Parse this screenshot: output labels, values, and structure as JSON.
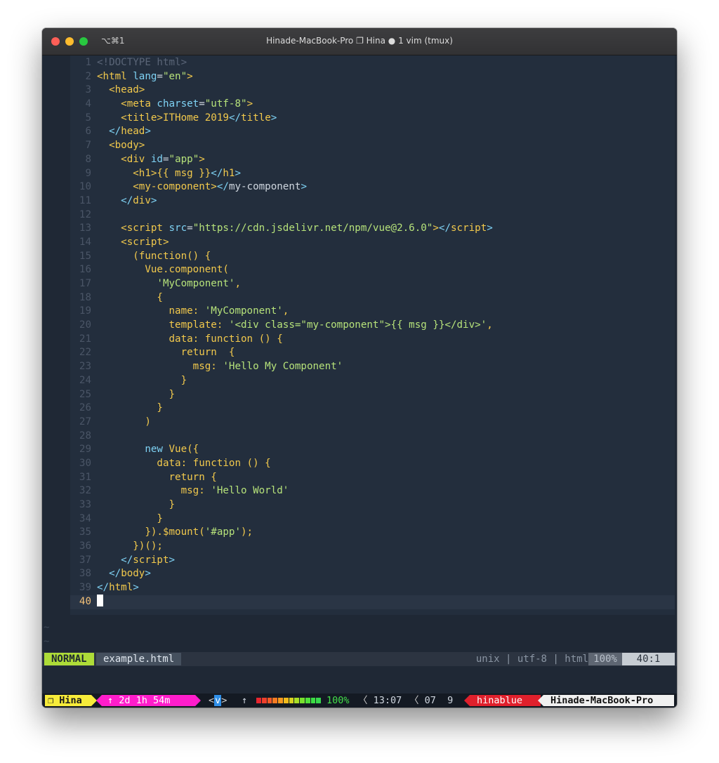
{
  "window": {
    "shortcut": "⌥⌘1",
    "title": "Hinade-MacBook-Pro ❐ Hina ● 1 vim (tmux)"
  },
  "editor": {
    "lines": [
      {
        "n": "1",
        "seg": [
          [
            "com",
            "<!DOCTYPE html>"
          ]
        ]
      },
      {
        "n": "2",
        "seg": [
          [
            "tag",
            "<html "
          ],
          [
            "attr",
            "lang"
          ],
          [
            "op",
            "="
          ],
          [
            "str",
            "\"en\""
          ],
          [
            "tag",
            ">"
          ]
        ]
      },
      {
        "n": "3",
        "seg": [
          [
            "text",
            "  "
          ],
          [
            "tag",
            "<head>"
          ]
        ]
      },
      {
        "n": "4",
        "seg": [
          [
            "text",
            "    "
          ],
          [
            "tag",
            "<meta "
          ],
          [
            "attr",
            "charset"
          ],
          [
            "op",
            "="
          ],
          [
            "str",
            "\"utf-8\""
          ],
          [
            "tag",
            ">"
          ]
        ]
      },
      {
        "n": "5",
        "seg": [
          [
            "text",
            "    "
          ],
          [
            "tag",
            "<title>"
          ],
          [
            "js",
            "ITHome 2019"
          ],
          [
            "br",
            "</"
          ],
          [
            "tag",
            "title"
          ],
          [
            "br",
            ">"
          ]
        ]
      },
      {
        "n": "6",
        "seg": [
          [
            "text",
            "  "
          ],
          [
            "br",
            "</"
          ],
          [
            "tag",
            "head"
          ],
          [
            "br",
            ">"
          ]
        ]
      },
      {
        "n": "7",
        "seg": [
          [
            "text",
            "  "
          ],
          [
            "tag",
            "<body>"
          ]
        ]
      },
      {
        "n": "8",
        "seg": [
          [
            "text",
            "    "
          ],
          [
            "tag",
            "<div "
          ],
          [
            "attr",
            "id"
          ],
          [
            "op",
            "="
          ],
          [
            "str",
            "\"app\""
          ],
          [
            "tag",
            ">"
          ]
        ]
      },
      {
        "n": "9",
        "seg": [
          [
            "text",
            "      "
          ],
          [
            "tag",
            "<h1>"
          ],
          [
            "js",
            "{{ msg }}"
          ],
          [
            "br",
            "</"
          ],
          [
            "tag",
            "h1"
          ],
          [
            "br",
            ">"
          ]
        ]
      },
      {
        "n": "10",
        "seg": [
          [
            "text",
            "      "
          ],
          [
            "tag",
            "<my-component>"
          ],
          [
            "br",
            "</"
          ],
          [
            "text",
            "my-component"
          ],
          [
            "br",
            ">"
          ]
        ]
      },
      {
        "n": "11",
        "seg": [
          [
            "text",
            "    "
          ],
          [
            "br",
            "</"
          ],
          [
            "tag",
            "div"
          ],
          [
            "br",
            ">"
          ]
        ]
      },
      {
        "n": "12",
        "seg": []
      },
      {
        "n": "13",
        "seg": [
          [
            "text",
            "    "
          ],
          [
            "tag",
            "<script "
          ],
          [
            "attr",
            "src"
          ],
          [
            "op",
            "="
          ],
          [
            "str",
            "\"https://cdn.jsdelivr.net/npm/vue@2.6.0\""
          ],
          [
            "tag",
            ">"
          ],
          [
            "br",
            "</"
          ],
          [
            "tag",
            "script"
          ],
          [
            "br",
            ">"
          ]
        ]
      },
      {
        "n": "14",
        "seg": [
          [
            "text",
            "    "
          ],
          [
            "tag",
            "<script>"
          ]
        ]
      },
      {
        "n": "15",
        "seg": [
          [
            "text",
            "      "
          ],
          [
            "js",
            "(function() {"
          ]
        ]
      },
      {
        "n": "16",
        "seg": [
          [
            "text",
            "        "
          ],
          [
            "js",
            "Vue.component("
          ]
        ]
      },
      {
        "n": "17",
        "seg": [
          [
            "text",
            "          "
          ],
          [
            "str",
            "'MyComponent'"
          ],
          [
            "js",
            ","
          ]
        ]
      },
      {
        "n": "18",
        "seg": [
          [
            "text",
            "          "
          ],
          [
            "js",
            "{"
          ]
        ]
      },
      {
        "n": "19",
        "seg": [
          [
            "text",
            "            "
          ],
          [
            "js",
            "name: "
          ],
          [
            "str",
            "'MyComponent'"
          ],
          [
            "js",
            ","
          ]
        ]
      },
      {
        "n": "20",
        "seg": [
          [
            "text",
            "            "
          ],
          [
            "js",
            "template: "
          ],
          [
            "str",
            "'<div class=\"my-component\">{{ msg }}</div>'"
          ],
          [
            "js",
            ","
          ]
        ]
      },
      {
        "n": "21",
        "seg": [
          [
            "text",
            "            "
          ],
          [
            "js",
            "data: function () {"
          ]
        ]
      },
      {
        "n": "22",
        "seg": [
          [
            "text",
            "              "
          ],
          [
            "js",
            "return  {"
          ]
        ]
      },
      {
        "n": "23",
        "seg": [
          [
            "text",
            "                "
          ],
          [
            "js",
            "msg: "
          ],
          [
            "str",
            "'Hello My Component'"
          ]
        ]
      },
      {
        "n": "24",
        "seg": [
          [
            "text",
            "              "
          ],
          [
            "js",
            "}"
          ]
        ]
      },
      {
        "n": "25",
        "seg": [
          [
            "text",
            "            "
          ],
          [
            "js",
            "}"
          ]
        ]
      },
      {
        "n": "26",
        "seg": [
          [
            "text",
            "          "
          ],
          [
            "js",
            "}"
          ]
        ]
      },
      {
        "n": "27",
        "seg": [
          [
            "text",
            "        "
          ],
          [
            "js",
            ")"
          ]
        ]
      },
      {
        "n": "28",
        "seg": []
      },
      {
        "n": "29",
        "seg": [
          [
            "text",
            "        "
          ],
          [
            "attr",
            "new "
          ],
          [
            "js",
            "Vue({"
          ]
        ]
      },
      {
        "n": "30",
        "seg": [
          [
            "text",
            "          "
          ],
          [
            "js",
            "data: function () {"
          ]
        ]
      },
      {
        "n": "31",
        "seg": [
          [
            "text",
            "            "
          ],
          [
            "js",
            "return {"
          ]
        ]
      },
      {
        "n": "32",
        "seg": [
          [
            "text",
            "              "
          ],
          [
            "js",
            "msg: "
          ],
          [
            "str",
            "'Hello World'"
          ]
        ]
      },
      {
        "n": "33",
        "seg": [
          [
            "text",
            "            "
          ],
          [
            "js",
            "}"
          ]
        ]
      },
      {
        "n": "34",
        "seg": [
          [
            "text",
            "          "
          ],
          [
            "js",
            "}"
          ]
        ]
      },
      {
        "n": "35",
        "seg": [
          [
            "text",
            "        "
          ],
          [
            "js",
            "}).$mount("
          ],
          [
            "str",
            "'#app'"
          ],
          [
            "js",
            ");"
          ]
        ]
      },
      {
        "n": "36",
        "seg": [
          [
            "text",
            "      "
          ],
          [
            "js",
            "})();"
          ]
        ]
      },
      {
        "n": "37",
        "seg": [
          [
            "text",
            "    "
          ],
          [
            "br",
            "</"
          ],
          [
            "tag",
            "script"
          ],
          [
            "br",
            ">"
          ]
        ]
      },
      {
        "n": "38",
        "seg": [
          [
            "text",
            "  "
          ],
          [
            "br",
            "</"
          ],
          [
            "tag",
            "body"
          ],
          [
            "br",
            ">"
          ]
        ]
      },
      {
        "n": "39",
        "seg": [
          [
            "br",
            "</"
          ],
          [
            "tag",
            "html"
          ],
          [
            "br",
            ">"
          ]
        ]
      }
    ],
    "current_line_number": "40",
    "tilde": "~"
  },
  "statusline": {
    "mode": "NORMAL",
    "filename": "example.html",
    "info": "unix | utf-8 | html",
    "percent": "100%",
    "position": "40:1"
  },
  "tmux": {
    "session": "❐ Hina",
    "uptime": "↑ 2d 1h 54m",
    "vmode_open": "<",
    "vmode_key": "v",
    "vmode_close": ">",
    "up_arrow": "↑",
    "battery_level": 1.0,
    "battery_colors": [
      "#e8262f",
      "#ee3f2b",
      "#f25a27",
      "#f57a22",
      "#f79a1e",
      "#f2bb1c",
      "#d8d21f",
      "#a9df27",
      "#78e02e",
      "#4fe03a",
      "#3cdc44",
      "#37d84c"
    ],
    "battery_percent": "100%",
    "time": "13:07",
    "date_day": "07",
    "date_num": "9",
    "username": "hinablue",
    "hostname": "Hinade-MacBook-Pro"
  }
}
